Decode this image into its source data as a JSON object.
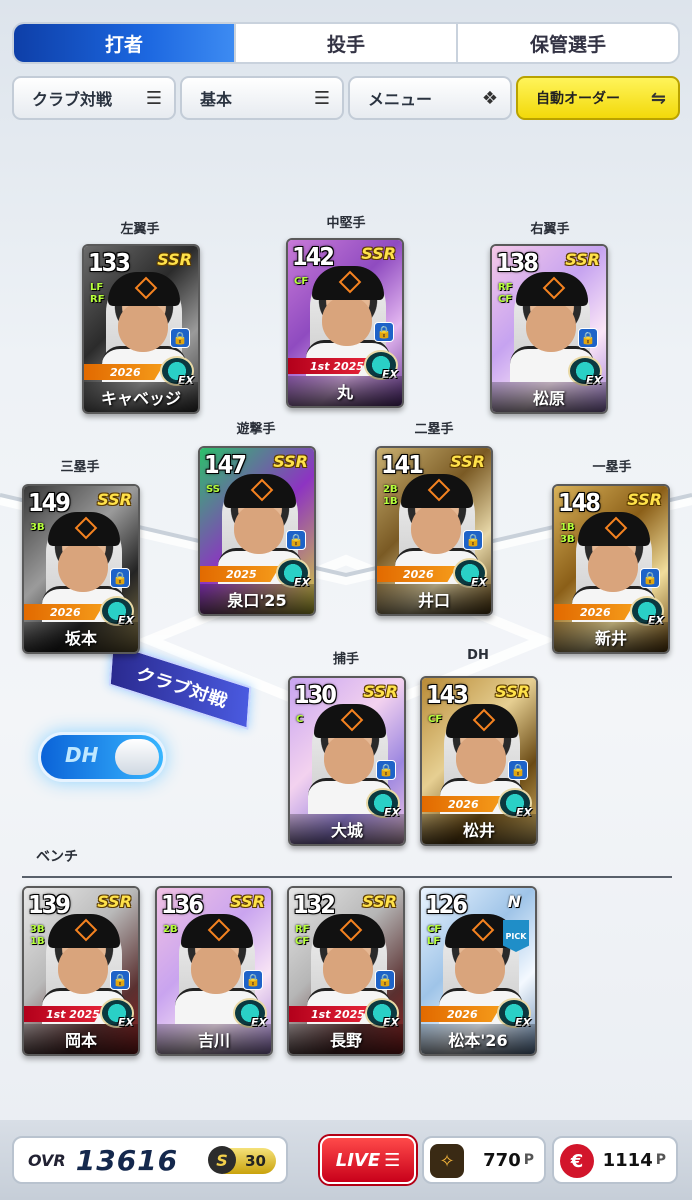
{
  "tabs": [
    "打者",
    "投手",
    "保管選手"
  ],
  "subbuttons": {
    "club": "クラブ対戦",
    "basic": "基本",
    "menu": "メニュー",
    "auto": "自動オーダー"
  },
  "positions": {
    "lf": "左翼手",
    "cf": "中堅手",
    "rf": "右翼手",
    "ss": "遊撃手",
    "second": "二塁手",
    "third": "三塁手",
    "first": "一塁手",
    "catcher": "捕手",
    "dh": "DH"
  },
  "lineup": [
    {
      "slot": "lf",
      "ovr": "133",
      "pos": "LF RF",
      "rarity": "SSR",
      "year": "2026",
      "name": "キャベッジ"
    },
    {
      "slot": "cf",
      "ovr": "142",
      "pos": "CF",
      "rarity": "SSR",
      "year": "1st 2025",
      "name": "丸"
    },
    {
      "slot": "rf",
      "ovr": "138",
      "pos": "RF CF",
      "rarity": "SSR",
      "year": "",
      "name": "松原"
    },
    {
      "slot": "ss",
      "ovr": "147",
      "pos": "SS",
      "rarity": "SSR",
      "year": "2025",
      "name": "泉口'25"
    },
    {
      "slot": "second",
      "ovr": "141",
      "pos": "2B 1B",
      "rarity": "SSR",
      "year": "2026",
      "name": "井口"
    },
    {
      "slot": "third",
      "ovr": "149",
      "pos": "3B",
      "rarity": "SSR",
      "year": "2026",
      "name": "坂本"
    },
    {
      "slot": "first",
      "ovr": "148",
      "pos": "1B 3B",
      "rarity": "SSR",
      "year": "2026",
      "name": "新井"
    },
    {
      "slot": "catcher",
      "ovr": "130",
      "pos": "C",
      "rarity": "SSR",
      "year": "",
      "name": "大城"
    },
    {
      "slot": "dh",
      "ovr": "143",
      "pos": "CF",
      "rarity": "SSR",
      "year": "2026",
      "name": "松井"
    }
  ],
  "club_badge": "クラブ対戦",
  "dh_toggle": "DH",
  "bench_label": "ベンチ",
  "bench": [
    {
      "ovr": "139",
      "pos": "3B 1B",
      "rarity": "SSR",
      "year": "1st 2025",
      "name": "岡本"
    },
    {
      "ovr": "136",
      "pos": "2B",
      "rarity": "SSR",
      "year": "",
      "name": "吉川"
    },
    {
      "ovr": "132",
      "pos": "RF CF",
      "rarity": "SSR",
      "year": "1st 2025",
      "name": "長野"
    },
    {
      "ovr": "126",
      "pos": "CF LF",
      "rarity": "N",
      "year": "2026",
      "name": "松本'26",
      "pick": "PICK"
    }
  ],
  "ex_label": "EX",
  "footer": {
    "ovr_label": "OVR",
    "ovr_value": "13616",
    "s_badge": "S",
    "s_value": "30",
    "live": "LIVE",
    "points1": "770",
    "points2": "1114",
    "p_unit": "P"
  }
}
